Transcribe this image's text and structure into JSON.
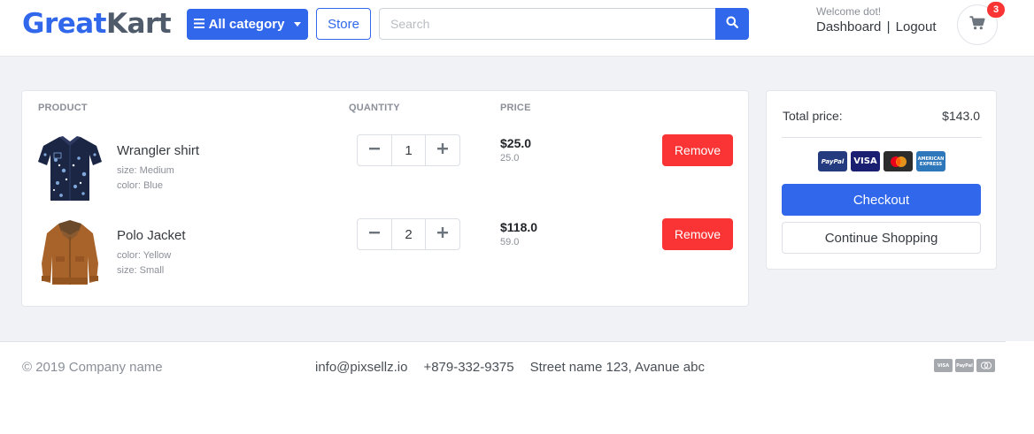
{
  "brand": {
    "part1": "Great",
    "part2": "Kart",
    "color_primary": "#3167eb",
    "color_secondary": "#4f5b6b"
  },
  "header": {
    "category_button": "All category",
    "store_button": "Store",
    "search_placeholder": "Search",
    "welcome": "Welcome dot!",
    "dashboard_link": "Dashboard",
    "separator": "|",
    "logout_link": "Logout",
    "cart_count": "3"
  },
  "cart": {
    "columns": {
      "product": "PRODUCT",
      "quantity": "QUANTITY",
      "price": "PRICE"
    },
    "items": [
      {
        "name": "Wrangler shirt",
        "meta1": "size: Medium",
        "meta2": "color: Blue",
        "quantity": "1",
        "price": "$25.0",
        "unit_price": "25.0",
        "remove_label": "Remove",
        "thumb_icon": "shirt-thumbnail"
      },
      {
        "name": "Polo Jacket",
        "meta1": "color: Yellow",
        "meta2": "size: Small",
        "quantity": "2",
        "price": "$118.0",
        "unit_price": "59.0",
        "remove_label": "Remove",
        "thumb_icon": "jacket-thumbnail"
      }
    ]
  },
  "summary": {
    "total_label": "Total price:",
    "total_value": "$143.0",
    "payment_icons": [
      "paypal-icon",
      "visa-icon",
      "mastercard-icon",
      "amex-icon"
    ],
    "paypal_text": "PayPal",
    "visa_text": "VISA",
    "amex_text": "AMERICAN EXPRESS",
    "checkout_label": "Checkout",
    "continue_label": "Continue Shopping"
  },
  "footer": {
    "copyright": "© 2019 Company name",
    "email": "info@pixsellz.io",
    "phone": "+879-332-9375",
    "address": "Street name 123, Avanue abc",
    "visa_text": "VISA",
    "paypal_text": "PayPal"
  },
  "colors": {
    "primary": "#3167eb",
    "danger": "#fa3434",
    "background": "#f0f2f5"
  }
}
